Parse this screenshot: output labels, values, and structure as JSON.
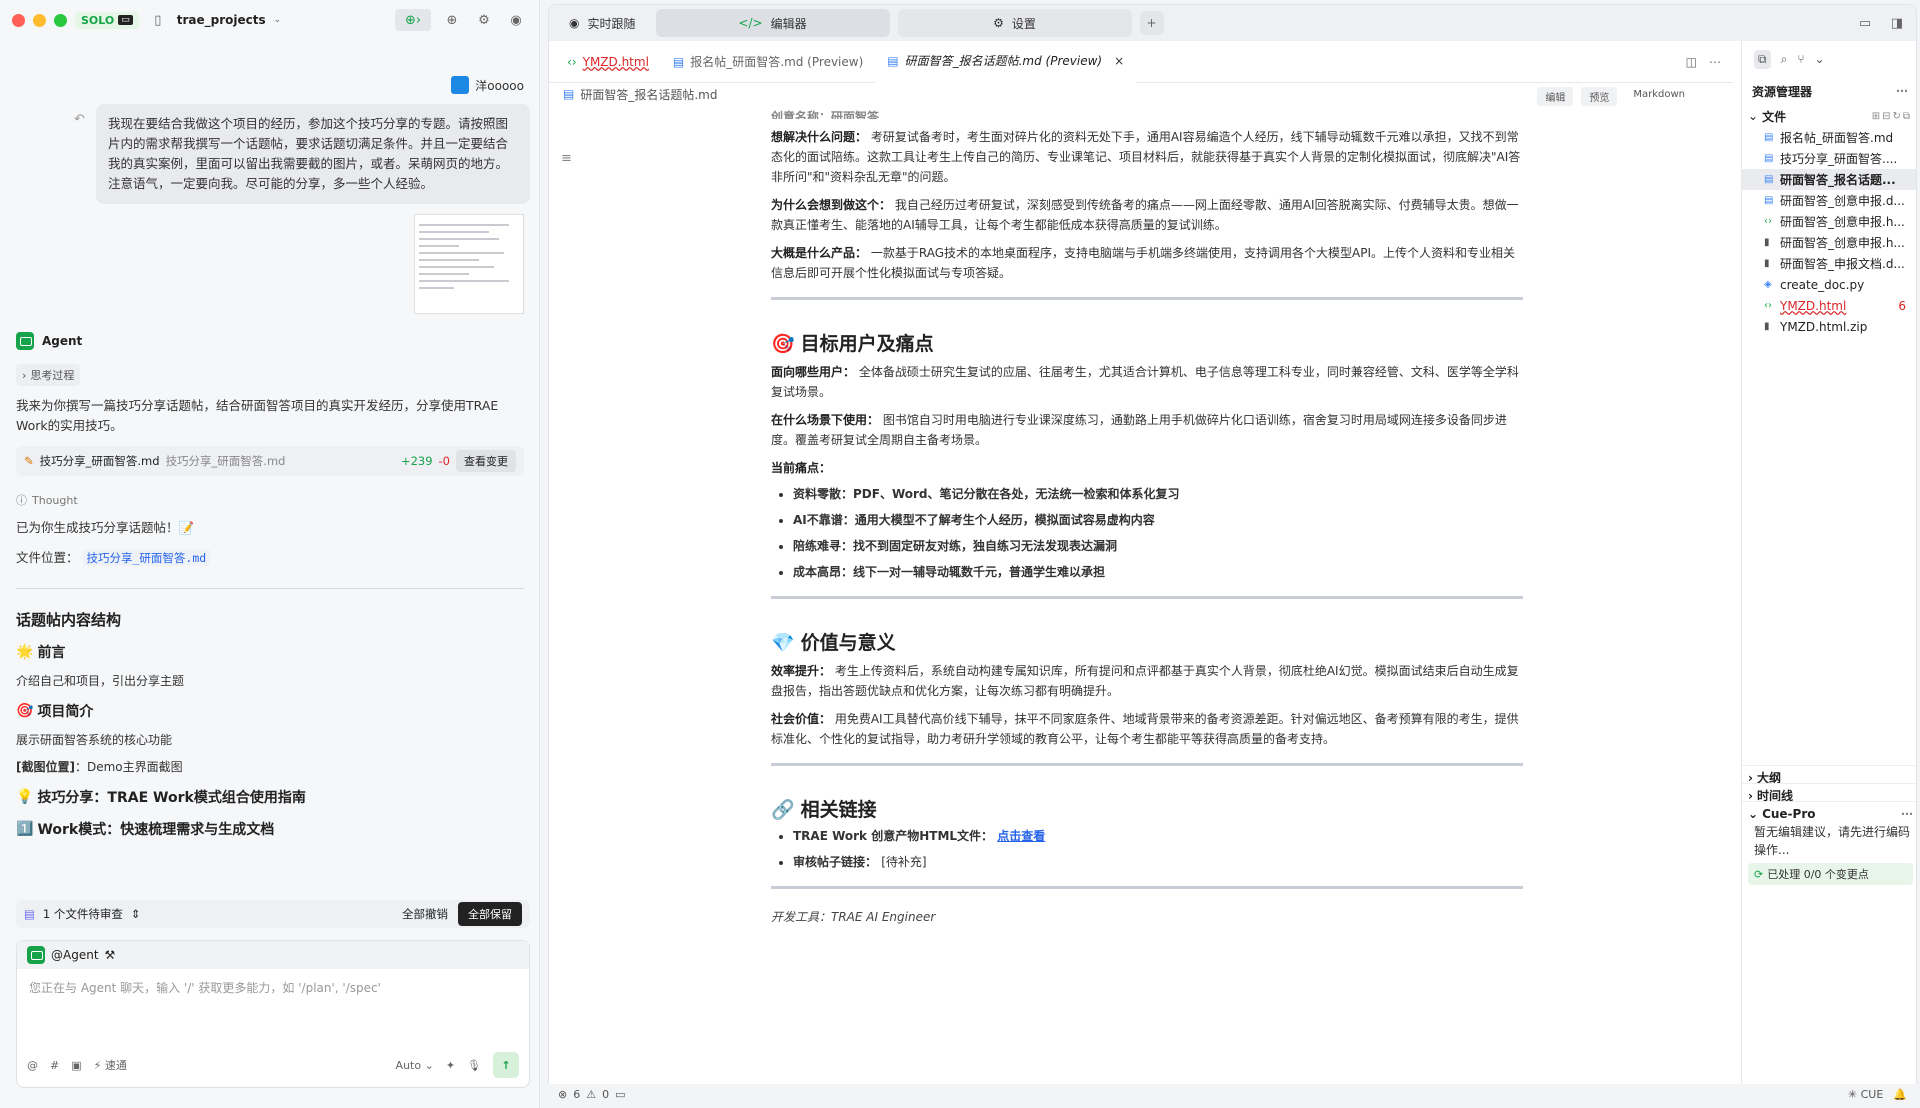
{
  "window": {
    "solo": "SOLO",
    "project": "trae_projects"
  },
  "chat": {
    "user_name": "洋ooooo",
    "user_message": "我现在要结合我做这个项目的经历，参加这个技巧分享的专题。请按照图片内的需求帮我撰写一个话题帖，要求话题切满足条件。并且一定要结合我的真实案例，里面可以留出我需要截的图片，或者。呆萌网页的地方。注意语气，一定要向我。尽可能的分享，多一些个人经验。",
    "agent_name": "Agent",
    "thinking_label": "思考过程",
    "intro": "我来为你撰写一篇技巧分享话题帖，结合研面智答项目的真实开发经历，分享使用TRAE Work的实用技巧。",
    "filecard": {
      "name": "技巧分享_研面智答.md",
      "path": "技巧分享_研面智答.md",
      "added": "+239",
      "removed": "-0",
      "button": "查看变更"
    },
    "thought_label": "Thought",
    "done_text": "已为你生成技巧分享话题帖！📝",
    "location_label": "文件位置：",
    "location_link": "技巧分享_研面智答.md",
    "structure_title": "话题帖内容结构",
    "s1_title": "前言",
    "s1_desc": "介绍自己和项目，引出分享主题",
    "s2_title": "项目简介",
    "s2_desc": "展示研面智答系统的核心功能",
    "s2_note_tag": "[截图位置]",
    "s2_note": "：Demo主界面截图",
    "s3_title": "技巧分享：TRAE Work模式组合使用指南",
    "s4_title": "Work模式：快速梳理需求与生成文档",
    "pending_label": "1 个文件待审查",
    "undo_all": "全部撤销",
    "keep_all": "全部保留",
    "composer_agent": "@Agent",
    "composer_placeholder": "您正在与 Agent 聊天，输入 '/' 获取更多能力，如 '/plan', '/spec'",
    "mode_fast": "速通",
    "model": "Auto"
  },
  "topbar": {
    "tab1": "实时跟随",
    "tab2": "编辑器",
    "tab3": "设置"
  },
  "filetabs": [
    {
      "label": "YMZD.html"
    },
    {
      "label": "报名帖_研面智答.md (Preview)"
    },
    {
      "label": "研面智答_报名话题帖.md (Preview)"
    }
  ],
  "breadcrumb": "研面智答_报名话题帖.md",
  "modes": {
    "edit": "编辑",
    "preview": "预览",
    "markdown": "Markdown"
  },
  "doc": {
    "cut_top": "创意名称：研面智答",
    "p1_label": "想解决什么问题：",
    "p1_text": "考研复试备考时，考生面对碎片化的资料无处下手，通用AI容易编造个人经历，线下辅导动辄数千元难以承担，又找不到常态化的面试陪练。这款工具让考生上传自己的简历、专业课笔记、项目材料后，就能获得基于真实个人背景的定制化模拟面试，彻底解决\"AI答非所问\"和\"资料杂乱无章\"的问题。",
    "p2_label": "为什么会想到做这个：",
    "p2_text": "我自己经历过考研复试，深刻感受到传统备考的痛点——网上面经零散、通用AI回答脱离实际、付费辅导太贵。想做一款真正懂考生、能落地的AI辅导工具，让每个考生都能低成本获得高质量的复试训练。",
    "p3_label": "大概是什么产品：",
    "p3_text": "一款基于RAG技术的本地桌面程序，支持电脑端与手机端多终端使用，支持调用各个大模型API。上传个人资料和专业相关信息后即可开展个性化模拟面试与专项答疑。",
    "h_users": "目标用户及痛点",
    "u1_label": "面向哪些用户：",
    "u1_text": "全体备战硕士研究生复试的应届、往届考生，尤其适合计算机、电子信息等理工科专业，同时兼容经管、文科、医学等全学科复试场景。",
    "u2_label": "在什么场景下使用：",
    "u2_text": "图书馆自习时用电脑进行专业课深度练习，通勤路上用手机做碎片化口语训练，宿舍复习时用局域网连接多设备同步进度。覆盖考研复试全周期自主备考场景。",
    "u3_label": "当前痛点：",
    "pains": [
      "资料零散：PDF、Word、笔记分散在各处，无法统一检索和体系化复习",
      "AI不靠谱：通用大模型不了解考生个人经历，模拟面试容易虚构内容",
      "陪练难寻：找不到固定研友对练，独自练习无法发现表达漏洞",
      "成本高昂：线下一对一辅导动辄数千元，普通学生难以承担"
    ],
    "h_value": "价值与意义",
    "v1_label": "效率提升：",
    "v1_text": "考生上传资料后，系统自动构建专属知识库，所有提问和点评都基于真实个人背景，彻底杜绝AI幻觉。模拟面试结束后自动生成复盘报告，指出答题优缺点和优化方案，让每次练习都有明确提升。",
    "v2_label": "社会价值：",
    "v2_text": "用免费AI工具替代高价线下辅导，抹平不同家庭条件、地域背景带来的备考资源差距。针对偏远地区、备考预算有限的考生，提供标准化、个性化的复试指导，助力考研升学领域的教育公平，让每个考生都能平等获得高质量的备考支持。",
    "h_links": "相关链接",
    "l1_label": "TRAE Work 创意产物HTML文件：",
    "l1_link": "点击查看",
    "l2_label": "审核帖子链接：",
    "l2_text": "[待补充]",
    "footer": "开发工具：TRAE AI Engineer"
  },
  "explorer": {
    "title": "资源管理器",
    "folder": "文件",
    "files": [
      {
        "name": "报名帖_研面智答.md",
        "icon": "md"
      },
      {
        "name": "技巧分享_研面智答....",
        "icon": "md"
      },
      {
        "name": "研面智答_报名话题...",
        "icon": "md"
      },
      {
        "name": "研面智答_创意申报.d...",
        "icon": "md"
      },
      {
        "name": "研面智答_创意申报.h...",
        "icon": "html"
      },
      {
        "name": "研面智答_创意申报.h...",
        "icon": "file"
      },
      {
        "name": "研面智答_申报文档.d...",
        "icon": "file"
      },
      {
        "name": "create_doc.py",
        "icon": "py"
      },
      {
        "name": "YMZD.html",
        "icon": "html",
        "badge": "6"
      },
      {
        "name": "YMZD.html.zip",
        "icon": "file"
      }
    ],
    "outline": "大纲",
    "timeline": "时间线",
    "cue": "Cue-Pro",
    "cue_text": "暂无编辑建议，请先进行编码操作...",
    "cue_foot": "已处理 0/0 个变更点"
  },
  "status": {
    "errors": "6",
    "warnings": "0",
    "cue": "CUE"
  }
}
